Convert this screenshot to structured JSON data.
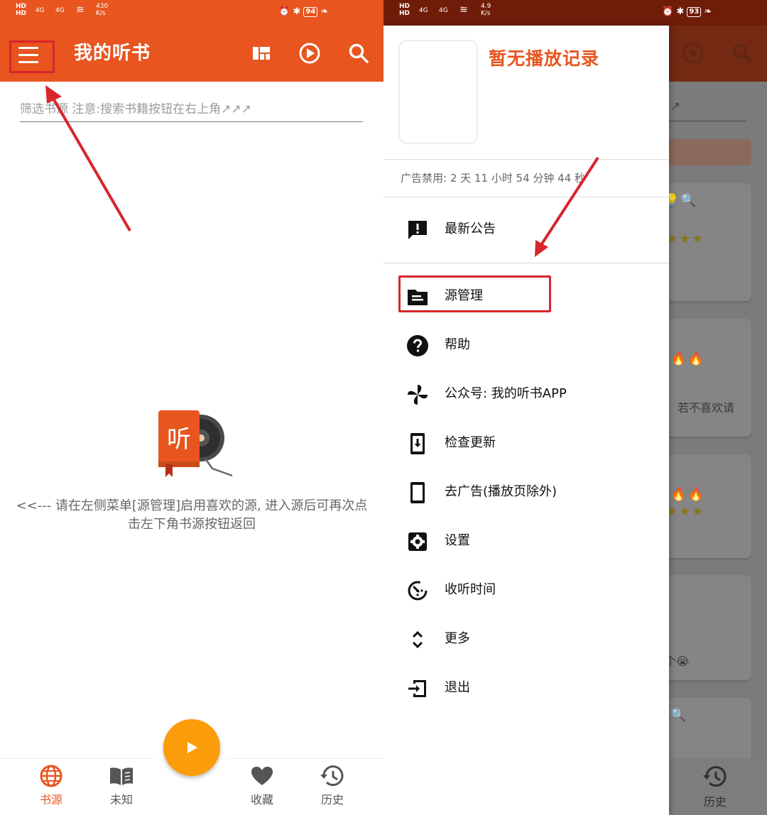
{
  "left_screen": {
    "status_bar": {
      "net_top": "HD",
      "net_bottom": "HD",
      "signal_1": "4G",
      "signal_2": "4G",
      "speed_value": "430",
      "speed_unit": "K/s",
      "battery": "94"
    },
    "app_bar": {
      "title": "我的听书",
      "icons": [
        "menu-icon",
        "grid-view-icon",
        "play-circle-icon",
        "search-icon"
      ]
    },
    "filter": {
      "placeholder": "筛选书源 注意:搜索书籍按钮在右上角↗↗↗"
    },
    "empty_state": {
      "logo_char": "听",
      "hint": "<<--- 请在左侧菜单[源管理]启用喜欢的源, 进入源后可再次点击左下角书源按钮返回"
    },
    "bottom_nav": [
      {
        "label": "书源",
        "icon": "globe-icon",
        "active": true
      },
      {
        "label": "未知",
        "icon": "book-icon",
        "active": false
      },
      {
        "label": "收藏",
        "icon": "heart-icon",
        "active": false
      },
      {
        "label": "历史",
        "icon": "history-icon",
        "active": false
      }
    ],
    "accent_color": "#e8551f",
    "fab_color": "#fb9d0b"
  },
  "right_screen": {
    "status_bar": {
      "net_top": "HD",
      "net_bottom": "HD",
      "signal_1": "4G",
      "signal_2": "4G",
      "speed_value": "4.9",
      "speed_unit": "K/s",
      "battery": "93"
    },
    "drawer": {
      "no_record": "暂无播放记录",
      "ad_timer": "广告禁用: 2 天 11 小时 54 分钟 44 秒",
      "items": [
        {
          "label": "最新公告",
          "icon": "announcement-icon"
        },
        {
          "label": "源管理",
          "icon": "folder-icon"
        },
        {
          "label": "帮助",
          "icon": "help-icon"
        },
        {
          "label": "公众号: 我的听书APP",
          "icon": "pinwheel-icon"
        },
        {
          "label": "检查更新",
          "icon": "download-icon"
        },
        {
          "label": "去广告(播放页除外)",
          "icon": "phone-icon"
        },
        {
          "label": "设置",
          "icon": "settings-icon"
        },
        {
          "label": "收听时间",
          "icon": "timer-icon"
        },
        {
          "label": "更多",
          "icon": "expand-icon"
        },
        {
          "label": "退出",
          "icon": "exit-icon"
        }
      ]
    },
    "background": {
      "filter_tail": "↗",
      "card_text_1": "若不喜欢请",
      "card_text_2": "这个😭",
      "nav_label": "历史"
    }
  }
}
